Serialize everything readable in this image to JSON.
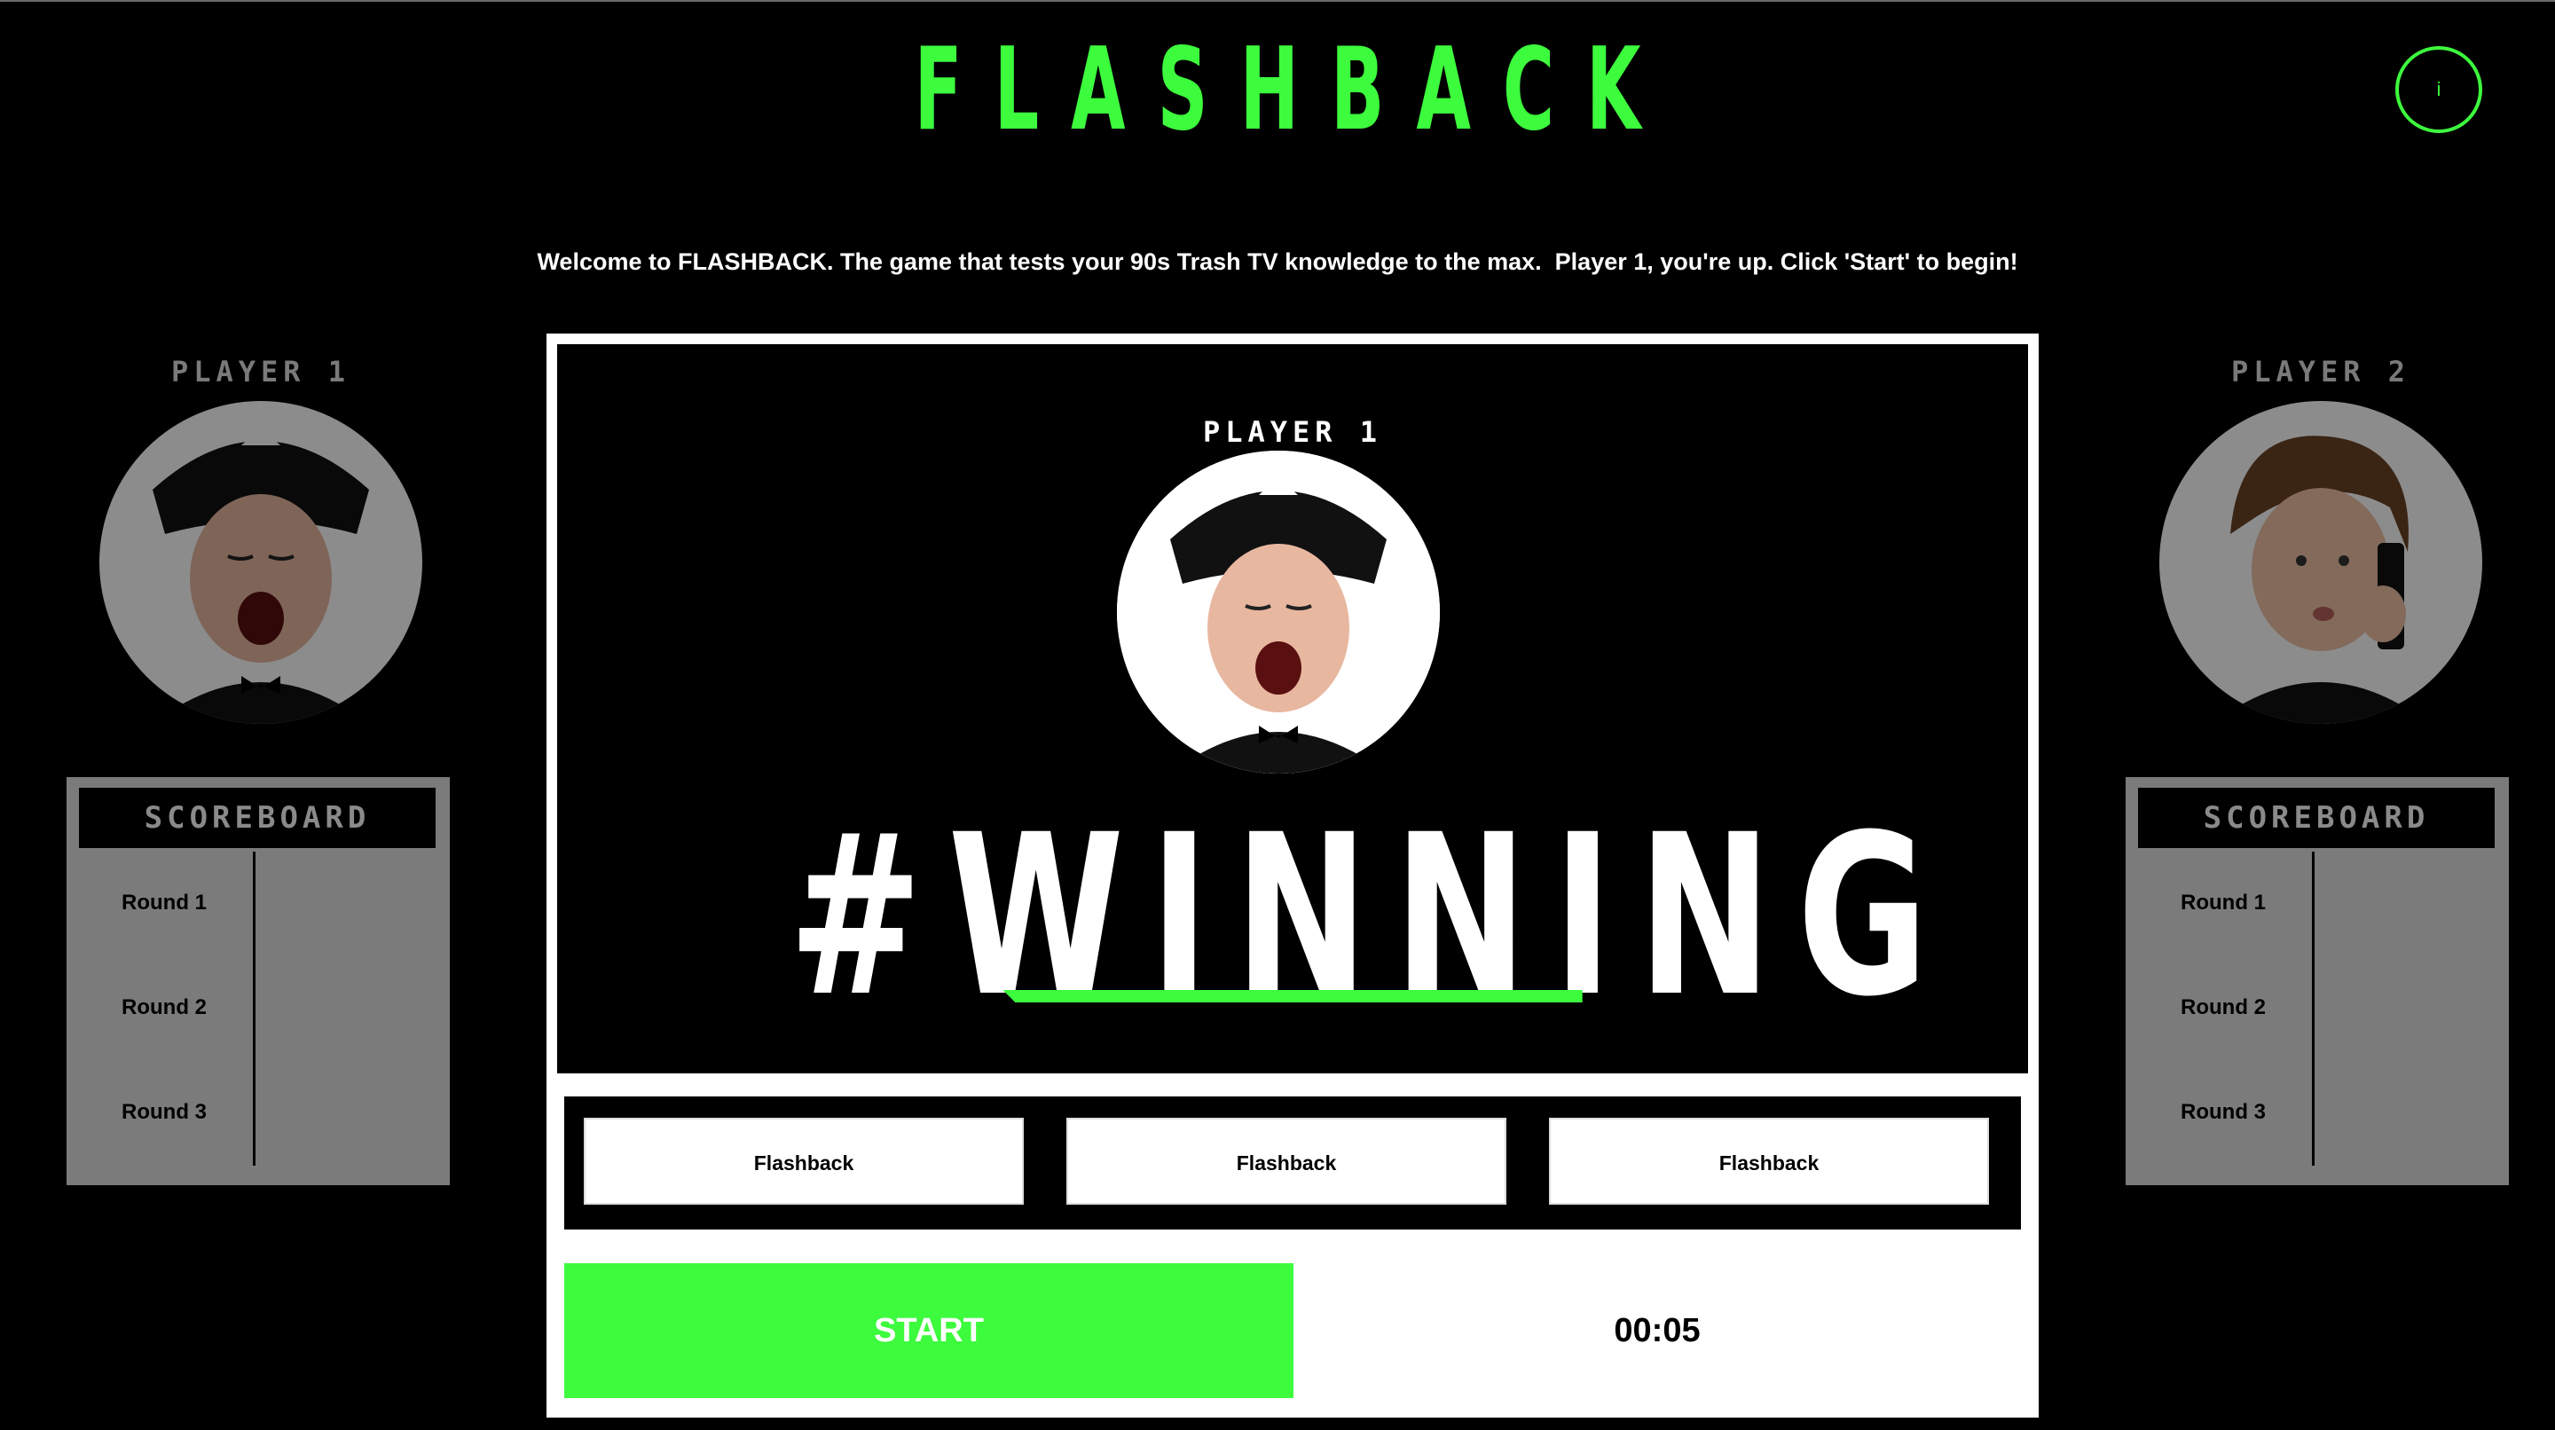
{
  "header": {
    "title": "FLASHBACK",
    "info_label": "i"
  },
  "welcome": "Welcome to FLASHBACK. The game that tests your 90s Trash TV knowledge to the max.  Player 1, you're up. Click 'Start' to begin!",
  "players": [
    {
      "label": "PLAYER 1",
      "avatar": "player-1-avatar"
    },
    {
      "label": "PLAYER 2",
      "avatar": "player-2-avatar"
    }
  ],
  "scoreboard": {
    "title": "SCOREBOARD",
    "rounds": [
      "Round 1",
      "Round 2",
      "Round 3"
    ]
  },
  "stage": {
    "current_player": "PLAYER 1",
    "status": "#WINNING",
    "choices": [
      "Flashback",
      "Flashback",
      "Flashback"
    ],
    "start_label": "START",
    "timer": "00:05"
  },
  "colors": {
    "accent": "#3dfb3d",
    "background": "#000000",
    "panel": "#7b7b7b"
  }
}
